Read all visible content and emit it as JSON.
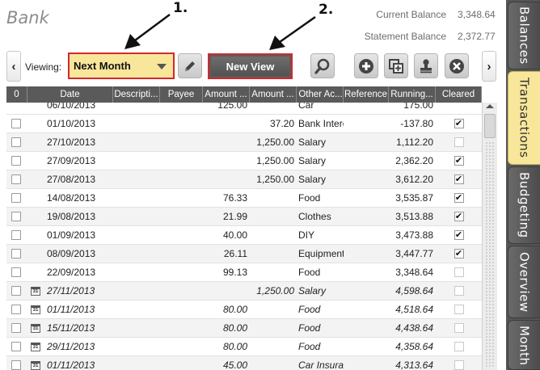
{
  "window": {
    "title": "Bank"
  },
  "balances": {
    "current_label": "Current Balance",
    "current_value": "3,348.64",
    "statement_label": "Statement Balance",
    "statement_value": "2,372.77"
  },
  "annotations": {
    "first": "1.",
    "second": "2."
  },
  "toolbar": {
    "prev_glyph": "‹",
    "next_glyph": "›",
    "viewing_label": "Viewing:",
    "view_selected": "Next Month",
    "new_view_label": "New View",
    "icons": [
      "pencil-icon",
      "search-icon",
      "add-icon",
      "duplicate-icon",
      "stamp-icon",
      "delete-icon"
    ]
  },
  "grid": {
    "columns": [
      "0",
      "Date",
      "Descripti...",
      "Payee",
      "Amount ...",
      "Amount ...",
      "Other Ac...",
      "Reference",
      "Running...",
      "Cleared"
    ],
    "partial_row": {
      "date": "06/10/2013",
      "amount_out": "125.00",
      "other_account": "Car",
      "running": "175.00"
    },
    "rows": [
      {
        "date": "01/10/2013",
        "description": "",
        "payee": "",
        "amount_out": "",
        "amount_in": "37.20",
        "other_account": "Bank Interest",
        "reference": "",
        "running": "-137.80",
        "cleared": true,
        "future": false
      },
      {
        "date": "27/10/2013",
        "description": "",
        "payee": "",
        "amount_out": "",
        "amount_in": "1,250.00",
        "other_account": "Salary",
        "reference": "",
        "running": "1,112.20",
        "cleared": false,
        "future": false
      },
      {
        "date": "27/09/2013",
        "description": "",
        "payee": "",
        "amount_out": "",
        "amount_in": "1,250.00",
        "other_account": "Salary",
        "reference": "",
        "running": "2,362.20",
        "cleared": true,
        "future": false
      },
      {
        "date": "27/08/2013",
        "description": "",
        "payee": "",
        "amount_out": "",
        "amount_in": "1,250.00",
        "other_account": "Salary",
        "reference": "",
        "running": "3,612.20",
        "cleared": true,
        "future": false
      },
      {
        "date": "14/08/2013",
        "description": "",
        "payee": "",
        "amount_out": "76.33",
        "amount_in": "",
        "other_account": "Food",
        "reference": "",
        "running": "3,535.87",
        "cleared": true,
        "future": false
      },
      {
        "date": "19/08/2013",
        "description": "",
        "payee": "",
        "amount_out": "21.99",
        "amount_in": "",
        "other_account": "Clothes",
        "reference": "",
        "running": "3,513.88",
        "cleared": true,
        "future": false
      },
      {
        "date": "01/09/2013",
        "description": "",
        "payee": "",
        "amount_out": "40.00",
        "amount_in": "",
        "other_account": "DIY",
        "reference": "",
        "running": "3,473.88",
        "cleared": true,
        "future": false
      },
      {
        "date": "08/09/2013",
        "description": "",
        "payee": "",
        "amount_out": "26.11",
        "amount_in": "",
        "other_account": "Equipment",
        "reference": "",
        "running": "3,447.77",
        "cleared": true,
        "future": false
      },
      {
        "date": "22/09/2013",
        "description": "",
        "payee": "",
        "amount_out": "99.13",
        "amount_in": "",
        "other_account": "Food",
        "reference": "",
        "running": "3,348.64",
        "cleared": false,
        "future": false
      },
      {
        "date": "27/11/2013",
        "description": "",
        "payee": "",
        "amount_out": "",
        "amount_in": "1,250.00",
        "other_account": "Salary",
        "reference": "",
        "running": "4,598.64",
        "cleared": false,
        "future": true
      },
      {
        "date": "01/11/2013",
        "description": "",
        "payee": "",
        "amount_out": "80.00",
        "amount_in": "",
        "other_account": "Food",
        "reference": "",
        "running": "4,518.64",
        "cleared": false,
        "future": true
      },
      {
        "date": "15/11/2013",
        "description": "",
        "payee": "",
        "amount_out": "80.00",
        "amount_in": "",
        "other_account": "Food",
        "reference": "",
        "running": "4,438.64",
        "cleared": false,
        "future": true
      },
      {
        "date": "29/11/2013",
        "description": "",
        "payee": "",
        "amount_out": "80.00",
        "amount_in": "",
        "other_account": "Food",
        "reference": "",
        "running": "4,358.64",
        "cleared": false,
        "future": true
      },
      {
        "date": "01/11/2013",
        "description": "",
        "payee": "",
        "amount_out": "45.00",
        "amount_in": "",
        "other_account": "Car Insurance",
        "reference": "",
        "running": "4,313.64",
        "cleared": false,
        "future": true
      }
    ],
    "calendar_glyph": "31",
    "check_glyph": "✔"
  },
  "side_tabs": [
    "Balances",
    "Transactions",
    "Budgeting",
    "Overview",
    "Month"
  ],
  "colors": {
    "accent_yellow": "#f8e79a",
    "highlight_red": "#d2282e",
    "header_dark": "#5a5a5a"
  }
}
